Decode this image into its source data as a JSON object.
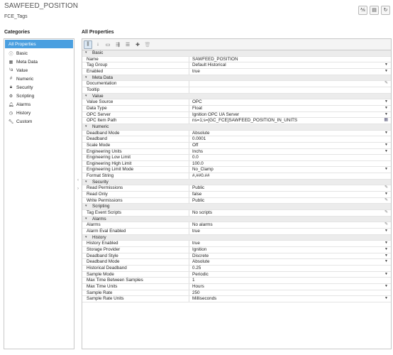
{
  "header": {
    "title": "SAWFEED_POSITION",
    "subtitle": "FCE_Tags",
    "buttons": [
      {
        "icon": "tag-test-icon",
        "glyph": "⅍"
      },
      {
        "icon": "document-icon",
        "glyph": "▤"
      },
      {
        "icon": "refresh-icon",
        "glyph": "↻"
      }
    ]
  },
  "categories": {
    "title": "Categories",
    "items": [
      {
        "label": "All Properties",
        "icon": "",
        "glyph": "",
        "selected": true
      },
      {
        "label": "Basic",
        "icon": "info-icon",
        "glyph": "ⓘ"
      },
      {
        "label": "Meta Data",
        "icon": "metadata-icon",
        "glyph": "▦"
      },
      {
        "label": "Value",
        "icon": "value-icon",
        "glyph": "¹a"
      },
      {
        "label": "Numeric",
        "icon": "numeric-icon",
        "glyph": "#"
      },
      {
        "label": "Security",
        "icon": "lock-icon",
        "glyph": "🔒︎"
      },
      {
        "label": "Scripting",
        "icon": "script-icon",
        "glyph": "⚙"
      },
      {
        "label": "Alarms",
        "icon": "alarm-icon",
        "glyph": "🔔︎"
      },
      {
        "label": "History",
        "icon": "history-icon",
        "glyph": "◷"
      },
      {
        "label": "Custom",
        "icon": "wrench-icon",
        "glyph": "🔧︎"
      }
    ]
  },
  "collapse": {
    "left": "‹",
    "right": "›"
  },
  "properties": {
    "title": "All Properties",
    "toolbar": [
      {
        "icon": "categorized-view-icon",
        "glyph": "⫼",
        "active": true
      },
      {
        "icon": "sort-alpha-icon",
        "glyph": "↓",
        "active": false
      },
      {
        "icon": "show-descriptions-icon",
        "glyph": "▭",
        "active": false
      },
      {
        "icon": "expand-all-icon",
        "glyph": "⇶",
        "active": false
      },
      {
        "icon": "collapse-all-icon",
        "glyph": "☰",
        "active": false
      },
      {
        "icon": "add-icon",
        "glyph": "✚",
        "active": false
      },
      {
        "icon": "delete-icon",
        "glyph": "🗑︎",
        "active": false,
        "disabled": true
      }
    ],
    "sections": [
      {
        "label": "Basic",
        "rows": [
          {
            "name": "Name",
            "value": "SAWFEED_POSITION",
            "control": ""
          },
          {
            "name": "Tag Group",
            "value": "Default Historical",
            "control": "dropdown"
          },
          {
            "name": "Enabled",
            "value": "true",
            "control": "dropdown"
          }
        ]
      },
      {
        "label": "Meta Data",
        "rows": [
          {
            "name": "Documentation",
            "value": "",
            "control": "edit"
          },
          {
            "name": "Tooltip",
            "value": "",
            "control": ""
          }
        ]
      },
      {
        "label": "Value",
        "rows": [
          {
            "name": "Value Source",
            "value": "OPC",
            "control": "dropdown"
          },
          {
            "name": "Data Type",
            "value": "Float",
            "control": "dropdown"
          },
          {
            "name": "OPC Server",
            "value": "Ignition OPC UA Server",
            "control": "dropdown"
          },
          {
            "name": "OPC Item Path",
            "value": "ns=1;s=[GC_FCE]SAWFEED_POSITION_IN_UNITS",
            "control": "browse"
          }
        ]
      },
      {
        "label": "Numeric",
        "rows": [
          {
            "name": "Deadband Mode",
            "value": "Absolute",
            "control": "dropdown"
          },
          {
            "name": "Deadband",
            "value": "0.0001",
            "control": ""
          },
          {
            "name": "Scale Mode",
            "value": "Off",
            "control": "dropdown"
          },
          {
            "name": "Engineering Units",
            "value": "Inchs",
            "control": "dropdown"
          },
          {
            "name": "Engineering Low Limit",
            "value": "0.0",
            "control": ""
          },
          {
            "name": "Engineering High Limit",
            "value": "100.0",
            "control": ""
          },
          {
            "name": "Engineering Limit Mode",
            "value": "No_Clamp",
            "control": "dropdown"
          },
          {
            "name": "Format String",
            "value": "#,##0.##",
            "control": ""
          }
        ]
      },
      {
        "label": "Security",
        "rows": [
          {
            "name": "Read Permissions",
            "value": "Public",
            "control": "edit"
          },
          {
            "name": "Read Only",
            "value": "false",
            "control": "dropdown"
          },
          {
            "name": "Write Permissions",
            "value": "Public",
            "control": "edit"
          }
        ]
      },
      {
        "label": "Scripting",
        "rows": [
          {
            "name": "Tag Event Scripts",
            "value": "No scripts",
            "control": "edit"
          }
        ]
      },
      {
        "label": "Alarms",
        "rows": [
          {
            "name": "Alarms",
            "value": "No alarms",
            "control": "edit"
          },
          {
            "name": "Alarm Eval Enabled",
            "value": "true",
            "control": "dropdown"
          }
        ]
      },
      {
        "label": "History",
        "rows": [
          {
            "name": "History Enabled",
            "value": "true",
            "control": "dropdown"
          },
          {
            "name": "Storage Provider",
            "value": "Ignition",
            "control": "dropdown"
          },
          {
            "name": "Deadband Style",
            "value": "Discrete",
            "control": "dropdown"
          },
          {
            "name": "Deadband Mode",
            "value": "Absolute",
            "control": "dropdown"
          },
          {
            "name": "Historical Deadband",
            "value": "0.25",
            "control": ""
          },
          {
            "name": "Sample Mode",
            "value": "Periodic",
            "control": "dropdown"
          },
          {
            "name": "Max Time Between Samples",
            "value": "1",
            "control": ""
          },
          {
            "name": "Max Time Units",
            "value": "Hours",
            "control": "dropdown"
          },
          {
            "name": "Sample Rate",
            "value": "250",
            "control": ""
          },
          {
            "name": "Sample Rate Units",
            "value": "Milliseconds",
            "control": "dropdown"
          }
        ]
      }
    ],
    "control_glyphs": {
      "dropdown": "▼",
      "edit": "✎",
      "browse": "▦"
    }
  }
}
